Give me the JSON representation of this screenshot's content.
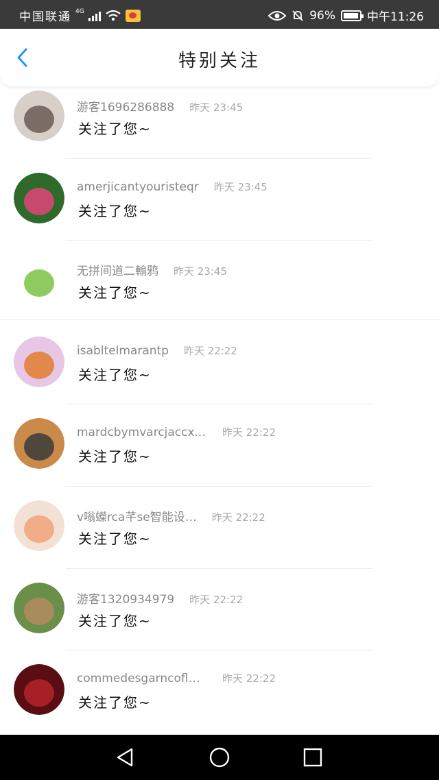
{
  "status_bar": {
    "carrier": "中国联通",
    "network": "4G",
    "battery_percent": "96%",
    "battery_level": 0.96,
    "time": "中午11:26"
  },
  "header": {
    "title": "特别关注",
    "back_icon": "chevron-left-icon"
  },
  "list": [
    {
      "name": "游客1696286888",
      "time": "昨天 23:45",
      "message": "关注了您~",
      "avatar_colors": [
        "#d9cfc9",
        "#6b5a55"
      ]
    },
    {
      "name": "amerjicantyouristeqr",
      "time": "昨天 23:45",
      "message": "关注了您~",
      "avatar_colors": [
        "#2e6b2a",
        "#e2447a"
      ]
    },
    {
      "name": "无拼间道二輸鸦",
      "time": "昨天 23:45",
      "message": "关注了您~",
      "avatar_colors": [
        "#ffffff",
        "#7bc243"
      ]
    },
    {
      "name": "isabltelmarantp",
      "time": "昨天 22:22",
      "message": "关注了您~",
      "avatar_colors": [
        "#e8c6e6",
        "#e07d2e"
      ]
    },
    {
      "name": "mardcbymvarcjaccxobs",
      "time": "昨天 22:22",
      "message": "关注了您~",
      "avatar_colors": [
        "#c98a4a",
        "#3a3a3a"
      ]
    },
    {
      "name": "v嗡蠑rca芊se智能设…",
      "time": "昨天 22:22",
      "message": "关注了您~",
      "avatar_colors": [
        "#f4e1d6",
        "#f0a27a"
      ]
    },
    {
      "name": "游客1320934979",
      "time": "昨天 22:22",
      "message": "关注了您~",
      "avatar_colors": [
        "#6a8f4a",
        "#b58b5e"
      ]
    },
    {
      "name": "commedesgarncoflnse",
      "time": "昨天 22:22",
      "message": "关注了您~",
      "avatar_colors": [
        "#5a0d12",
        "#b5242b"
      ]
    }
  ],
  "nav_bar": {
    "back_icon": "triangle-back-icon",
    "home_icon": "circle-home-icon",
    "recents_icon": "square-recents-icon"
  },
  "colors": {
    "accent": "#2196f3",
    "status_bar_bg": "#3a3a3a",
    "nav_bar_bg": "#000000"
  }
}
